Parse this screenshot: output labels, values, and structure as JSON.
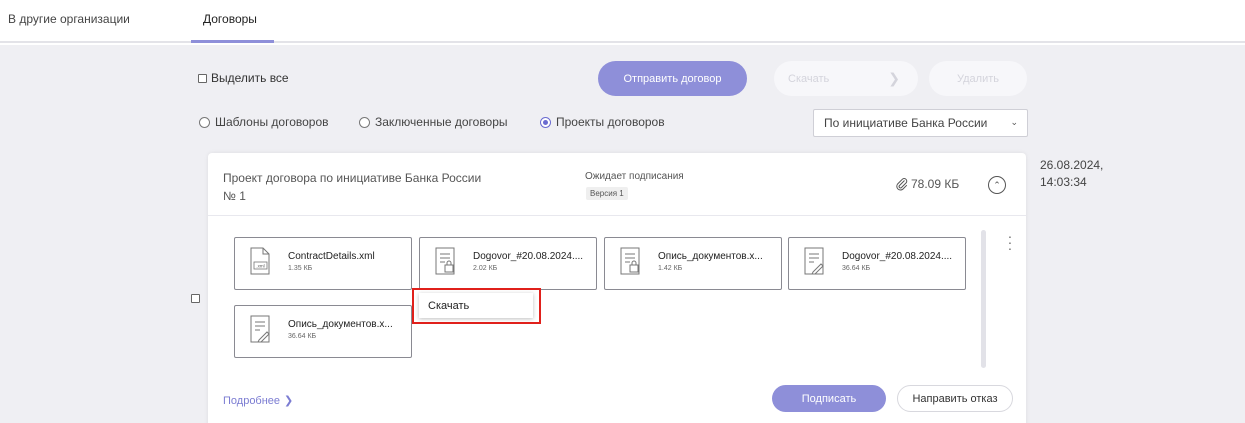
{
  "tabs": [
    {
      "label": "В другие организации"
    },
    {
      "label": "Договоры",
      "active": true
    }
  ],
  "toolbar": {
    "select_all": "Выделить все",
    "send_label": "Отправить договор",
    "download_label": "Скачать",
    "delete_label": "Удалить"
  },
  "filters": {
    "templates": "Шаблоны договоров",
    "concluded": "Заключенные договоры",
    "projects": "Проекты договоров",
    "selected": "projects",
    "initiator_select": "По инициативе Банка России"
  },
  "card": {
    "title": "Проект договора по инициативе Банка России",
    "number": "№ 1",
    "status": "Ожидает подписания",
    "version": "Версия 1",
    "total_size": "78.09 КБ",
    "date": "26.08.2024,",
    "time": "14:03:34",
    "files": [
      {
        "name": "ContractDetails.xml",
        "size": "1.35 КБ",
        "icon": "xml-file-icon"
      },
      {
        "name": "Dogovor_#20.08.2024....",
        "size": "2.02 КБ",
        "icon": "locked-document-icon"
      },
      {
        "name": "Опись_документов.x...",
        "size": "1.42 КБ",
        "icon": "locked-document-icon"
      },
      {
        "name": "Dogovor_#20.08.2024....",
        "size": "36.64 КБ",
        "icon": "signed-document-icon"
      },
      {
        "name": "Опись_документов.x...",
        "size": "36.64 КБ",
        "icon": "signed-document-icon"
      }
    ],
    "more_label": "Подробнее",
    "sign_label": "Подписать",
    "reject_label": "Направить отказ"
  },
  "context_menu": {
    "item": "Скачать"
  },
  "colors": {
    "accent": "#8e8fd9",
    "highlight": "#e0201b",
    "background": "#efeff3"
  }
}
